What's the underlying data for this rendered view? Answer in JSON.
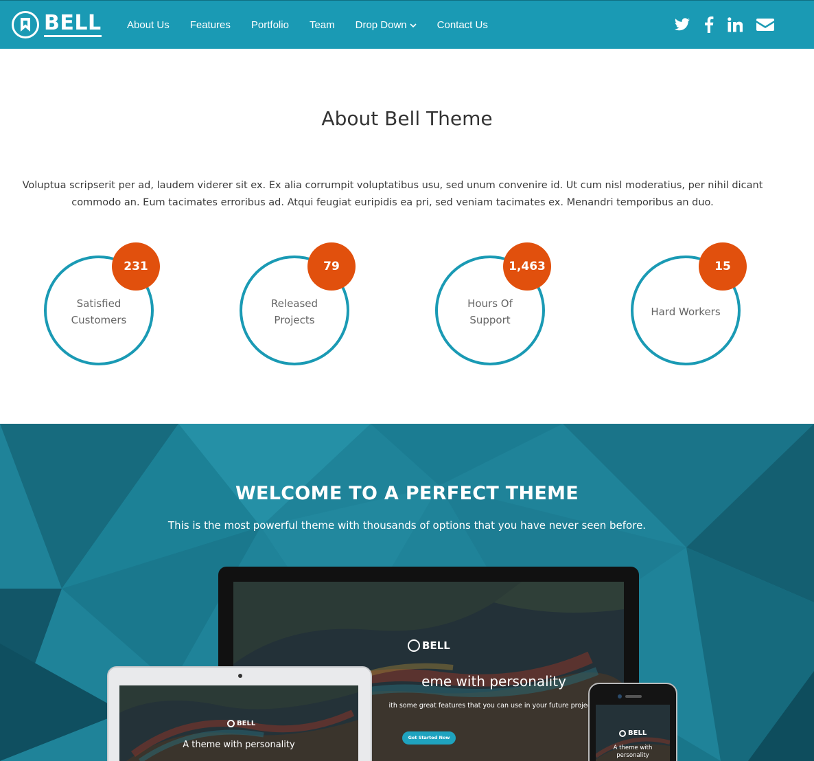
{
  "brand": {
    "name": "BELL"
  },
  "nav": {
    "items": [
      {
        "label": "About Us"
      },
      {
        "label": "Features"
      },
      {
        "label": "Portfolio"
      },
      {
        "label": "Team"
      },
      {
        "label": "Drop Down"
      },
      {
        "label": "Contact Us"
      }
    ],
    "social": [
      "twitter-icon",
      "facebook-icon",
      "linkedin-icon",
      "envelope-icon"
    ]
  },
  "about": {
    "title": "About Bell Theme",
    "text": "Voluptua scripserit per ad, laudem viderer sit ex. Ex alia corrumpit voluptatibus usu, sed unum convenire id. Ut cum nisl moderatius, per nihil dicant commodo an. Eum tacimates erroribus ad. Atqui feugiat euripidis ea pri, sed veniam tacimates ex. Menandri temporibus an duo.",
    "stats": [
      {
        "value": "231",
        "label": "Satisfied Customers"
      },
      {
        "value": "79",
        "label": "Released Projects"
      },
      {
        "value": "1,463",
        "label": "Hours Of Support"
      },
      {
        "value": "15",
        "label": "Hard Workers"
      }
    ]
  },
  "hero": {
    "title": "WELCOME TO A PERFECT THEME",
    "subtitle": "This is the most powerful theme with thousands of options that you have never seen before."
  },
  "devices": {
    "monitor": {
      "logo": "BELL",
      "headline": "eme with personality",
      "sub": "ith some great features that you can use in your future projects.",
      "button": "Get Started Now"
    },
    "laptop": {
      "logo": "BELL",
      "headline": "A theme with personality"
    },
    "phone": {
      "logo": "BELL",
      "headline_line1": "A theme with",
      "headline_line2": "personality"
    }
  },
  "colors": {
    "primary": "#1a9ab4",
    "accent": "#e1500d",
    "hero_bg": "#1e7f95"
  }
}
